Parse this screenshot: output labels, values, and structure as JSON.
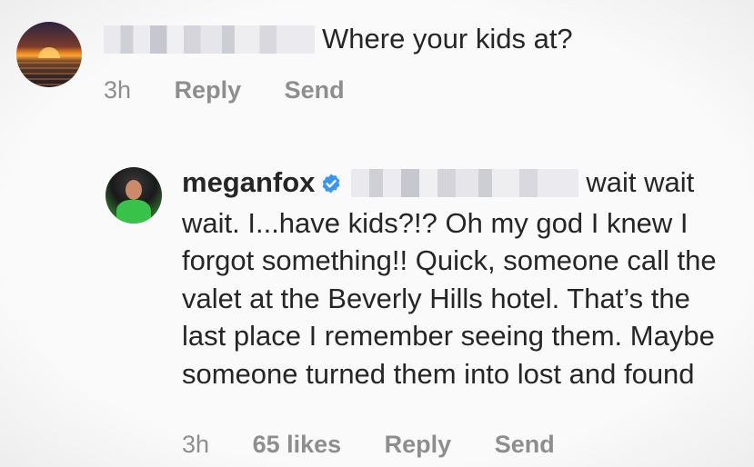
{
  "comments": [
    {
      "username_redacted": true,
      "text": "Where your kids at?",
      "time": "3h",
      "reply_label": "Reply",
      "send_label": "Send"
    },
    {
      "username": "meganfox",
      "verified": true,
      "mention_redacted": true,
      "text": "wait wait wait. I...have kids?!? Oh my god I knew I forgot something!! Quick, someone call the valet at the Beverly Hills hotel. That’s the last place I remember seeing them. Maybe someone turned them into lost and found",
      "time": "3h",
      "likes": "65 likes",
      "reply_label": "Reply",
      "send_label": "Send"
    }
  ],
  "colors": {
    "text": "#262626",
    "meta": "#8e8e8e",
    "verified": "#3897f0",
    "background": "#fafafa"
  }
}
